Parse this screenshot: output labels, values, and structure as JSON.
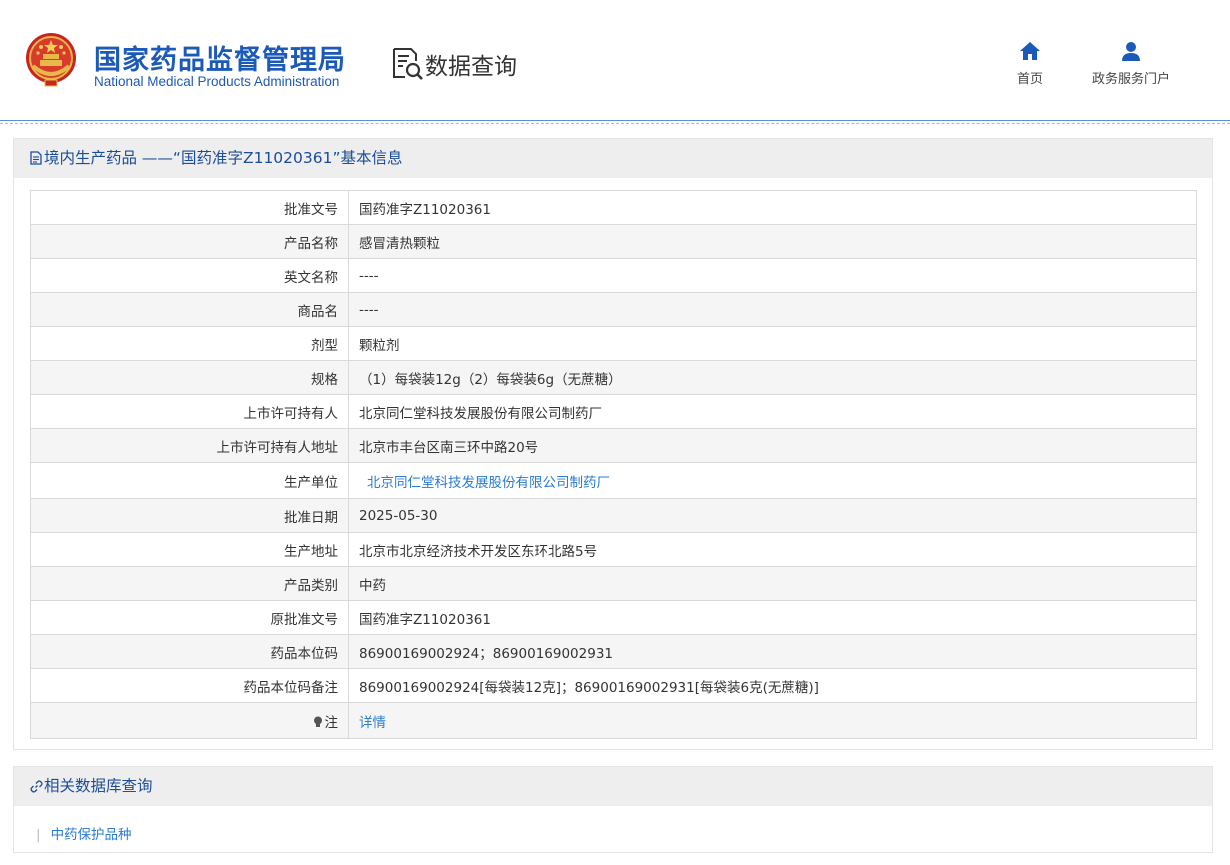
{
  "header": {
    "org_name_cn": "国家药品监督管理局",
    "org_name_en": "National Medical Products Administration",
    "section_title": "数据查询",
    "nav": [
      {
        "label": "首页",
        "icon": "home-icon"
      },
      {
        "label": "政务服务门户",
        "icon": "user-icon"
      }
    ]
  },
  "colors": {
    "brand_blue": "#1b5ab8",
    "link_blue": "#2a7bd4",
    "panel_title_blue": "#1b4d9a",
    "row_alt": "#f5f5f5"
  },
  "info_panel": {
    "title": "境内生产药品 ——“国药准字Z11020361”基本信息",
    "rows": [
      {
        "label": "批准文号",
        "value": "国药准字Z11020361"
      },
      {
        "label": "产品名称",
        "value": "感冒清热颗粒"
      },
      {
        "label": "英文名称",
        "value": "----"
      },
      {
        "label": "商品名",
        "value": "----"
      },
      {
        "label": "剂型",
        "value": "颗粒剂"
      },
      {
        "label": "规格",
        "value": "（1）每袋装12g（2）每袋装6g（无蔗糖）"
      },
      {
        "label": "上市许可持有人",
        "value": "北京同仁堂科技发展股份有限公司制药厂"
      },
      {
        "label": "上市许可持有人地址",
        "value": "北京市丰台区南三环中路20号"
      },
      {
        "label": "生产单位",
        "value": "北京同仁堂科技发展股份有限公司制药厂"
      },
      {
        "label": "批准日期",
        "value": "2025-05-30"
      },
      {
        "label": "生产地址",
        "value": "北京市北京经济技术开发区东环北路5号"
      },
      {
        "label": "产品类别",
        "value": "中药"
      },
      {
        "label": "原批准文号",
        "value": "国药准字Z11020361"
      },
      {
        "label": "药品本位码",
        "value": "86900169002924；86900169002931"
      },
      {
        "label": "药品本位码备注",
        "value": "86900169002924[每袋装12克]；86900169002931[每袋装6克(无蔗糖)]"
      },
      {
        "label": "注",
        "value": "详情"
      }
    ]
  },
  "related_panel": {
    "title": "相关数据库查询",
    "links": [
      "中药保护品种"
    ]
  }
}
